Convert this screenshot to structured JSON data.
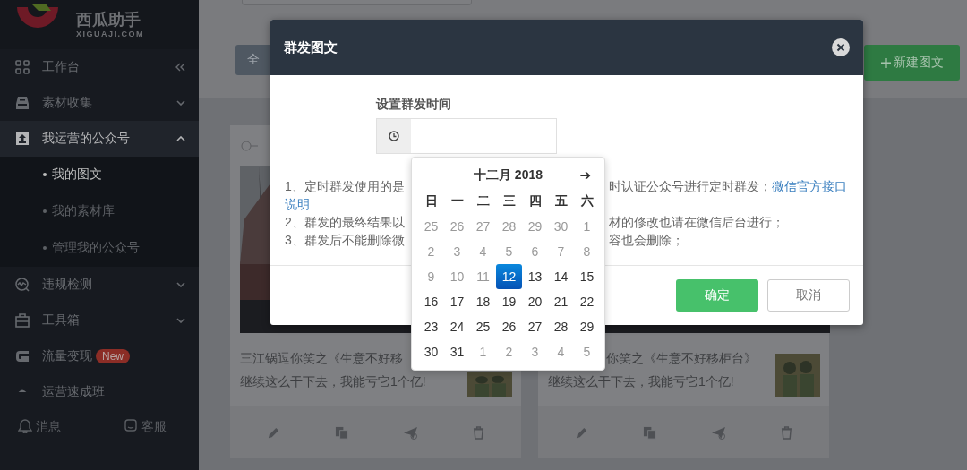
{
  "sidebar": {
    "logo": {
      "name": "西瓜助手",
      "domain": "XIGUAJI.COM"
    },
    "items": [
      {
        "kind": "dashboard",
        "label": "工作台",
        "collapse_button": true
      },
      {
        "kind": "inbox",
        "label": "素材收集",
        "expanded": false
      },
      {
        "kind": "upload",
        "label": "我运营的公众号",
        "expanded": true,
        "children": [
          {
            "label": "我的图文",
            "selected": true
          },
          {
            "label": "我的素材库",
            "selected": false
          },
          {
            "label": "管理我的公众号",
            "selected": false
          }
        ]
      },
      {
        "kind": "monitor",
        "label": "违规检测",
        "expanded": false
      },
      {
        "kind": "toolbox",
        "label": "工具箱",
        "expanded": false
      },
      {
        "kind": "traffic",
        "label": "流量变现",
        "badge": "New"
      },
      {
        "kind": "course",
        "label": "运营速成班"
      }
    ],
    "footer": [
      {
        "kind": "bell",
        "label": "消息"
      },
      {
        "kind": "support",
        "label": "客服"
      }
    ]
  },
  "toolbar": {
    "filter_button": "全",
    "new_button": "新建图文"
  },
  "cards": [
    {
      "title_lines": [
        "三江锅逗你笑之《生意不好移",
        "继续这么干下去，我能亏它1个亿!"
      ]
    },
    {
      "title_lines": [
        "你笑之《生意不好移柜台》",
        "继续这么干下去，我能亏它1个亿!"
      ]
    }
  ],
  "modal": {
    "title": "群发图文",
    "field_label": "设置群发时间",
    "notes": [
      {
        "left": "1、定时群发使用的是",
        "right": "时认证公众号进行定时群发；",
        "link": "微信官方接口"
      },
      {
        "link": "说明"
      },
      {
        "left": "2、群发的最终结果以",
        "right": "材的修改也请在微信后台进行；"
      },
      {
        "left": "3、群发后不能删除微",
        "right": "容也会删除；"
      }
    ],
    "buttons": [
      {
        "kind": "primary",
        "label": "确定"
      },
      {
        "kind": "secondary",
        "label": "取消"
      }
    ]
  },
  "datepicker": {
    "month": "十二月 2018",
    "next": "➔",
    "weekdays": [
      "日",
      "一",
      "二",
      "三",
      "四",
      "五",
      "六"
    ],
    "days": [
      {
        "day": "25",
        "muted": true,
        "selected": false
      },
      {
        "day": "26",
        "muted": true,
        "selected": false
      },
      {
        "day": "27",
        "muted": true,
        "selected": false
      },
      {
        "day": "28",
        "muted": true,
        "selected": false
      },
      {
        "day": "29",
        "muted": true,
        "selected": false
      },
      {
        "day": "30",
        "muted": true,
        "selected": false
      },
      {
        "day": "1",
        "muted": true,
        "selected": false
      },
      {
        "day": "2",
        "muted": true,
        "selected": false
      },
      {
        "day": "3",
        "muted": true,
        "selected": false
      },
      {
        "day": "4",
        "muted": true,
        "selected": false
      },
      {
        "day": "5",
        "muted": true,
        "selected": false
      },
      {
        "day": "6",
        "muted": true,
        "selected": false
      },
      {
        "day": "7",
        "muted": true,
        "selected": false
      },
      {
        "day": "8",
        "muted": true,
        "selected": false
      },
      {
        "day": "9",
        "muted": true,
        "selected": false
      },
      {
        "day": "10",
        "muted": true,
        "selected": false
      },
      {
        "day": "11",
        "muted": true,
        "selected": false
      },
      {
        "day": "12",
        "muted": false,
        "selected": true
      },
      {
        "day": "13",
        "muted": false,
        "selected": false
      },
      {
        "day": "14",
        "muted": false,
        "selected": false
      },
      {
        "day": "15",
        "muted": false,
        "selected": false
      },
      {
        "day": "16",
        "muted": false,
        "selected": false
      },
      {
        "day": "17",
        "muted": false,
        "selected": false
      },
      {
        "day": "18",
        "muted": false,
        "selected": false
      },
      {
        "day": "19",
        "muted": false,
        "selected": false
      },
      {
        "day": "20",
        "muted": false,
        "selected": false
      },
      {
        "day": "21",
        "muted": false,
        "selected": false
      },
      {
        "day": "22",
        "muted": false,
        "selected": false
      },
      {
        "day": "23",
        "muted": false,
        "selected": false
      },
      {
        "day": "24",
        "muted": false,
        "selected": false
      },
      {
        "day": "25",
        "muted": false,
        "selected": false
      },
      {
        "day": "26",
        "muted": false,
        "selected": false
      },
      {
        "day": "27",
        "muted": false,
        "selected": false
      },
      {
        "day": "28",
        "muted": false,
        "selected": false
      },
      {
        "day": "29",
        "muted": false,
        "selected": false
      },
      {
        "day": "30",
        "muted": false,
        "selected": false
      },
      {
        "day": "31",
        "muted": false,
        "selected": false
      },
      {
        "day": "1",
        "muted": true,
        "selected": false
      },
      {
        "day": "2",
        "muted": true,
        "selected": false
      },
      {
        "day": "3",
        "muted": true,
        "selected": false
      },
      {
        "day": "4",
        "muted": true,
        "selected": false
      },
      {
        "day": "5",
        "muted": true,
        "selected": false
      }
    ]
  }
}
